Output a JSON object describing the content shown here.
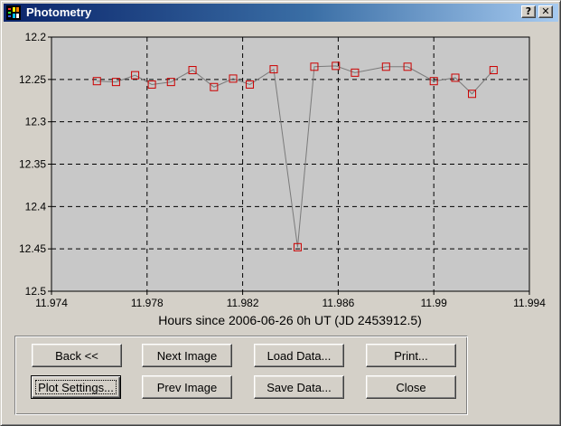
{
  "window": {
    "title": "Photometry",
    "help_button": "?",
    "close_button": "✕"
  },
  "chart_data": {
    "type": "line",
    "title": "",
    "xlabel": "Hours since 2006-06-26 0h UT (JD 2453912.5)",
    "ylabel": "",
    "xlim": [
      11.974,
      11.994
    ],
    "ylim": [
      12.2,
      12.5
    ],
    "y_inverted": true,
    "x_ticks": [
      "11.974",
      "11.978",
      "11.982",
      "11.986",
      "11.99",
      "11.994"
    ],
    "y_ticks": [
      "12.2",
      "12.25",
      "12.3",
      "12.35",
      "12.4",
      "12.45",
      "12.5"
    ],
    "grid": true,
    "series_color": "#cc0000",
    "line_color": "#7a7a7a",
    "plot_background": "#c8c8c8",
    "marker": "square",
    "x": [
      11.9759,
      11.9767,
      11.9775,
      11.9782,
      11.979,
      11.9799,
      11.9808,
      11.9816,
      11.9823,
      11.9833,
      11.9843,
      11.985,
      11.9859,
      11.9867,
      11.988,
      11.9889,
      11.99,
      11.9909,
      11.9916,
      11.9925
    ],
    "y": [
      12.252,
      12.253,
      12.245,
      12.256,
      12.253,
      12.239,
      12.259,
      12.249,
      12.256,
      12.238,
      12.448,
      12.235,
      12.234,
      12.242,
      12.235,
      12.235,
      12.252,
      12.248,
      12.267,
      12.239
    ]
  },
  "buttons": {
    "back": "Back <<",
    "next_image": "Next Image",
    "load_data": "Load Data...",
    "print": "Print...",
    "plot_settings": "Plot Settings...",
    "prev_image": "Prev Image",
    "save_data": "Save Data...",
    "close": "Close"
  }
}
